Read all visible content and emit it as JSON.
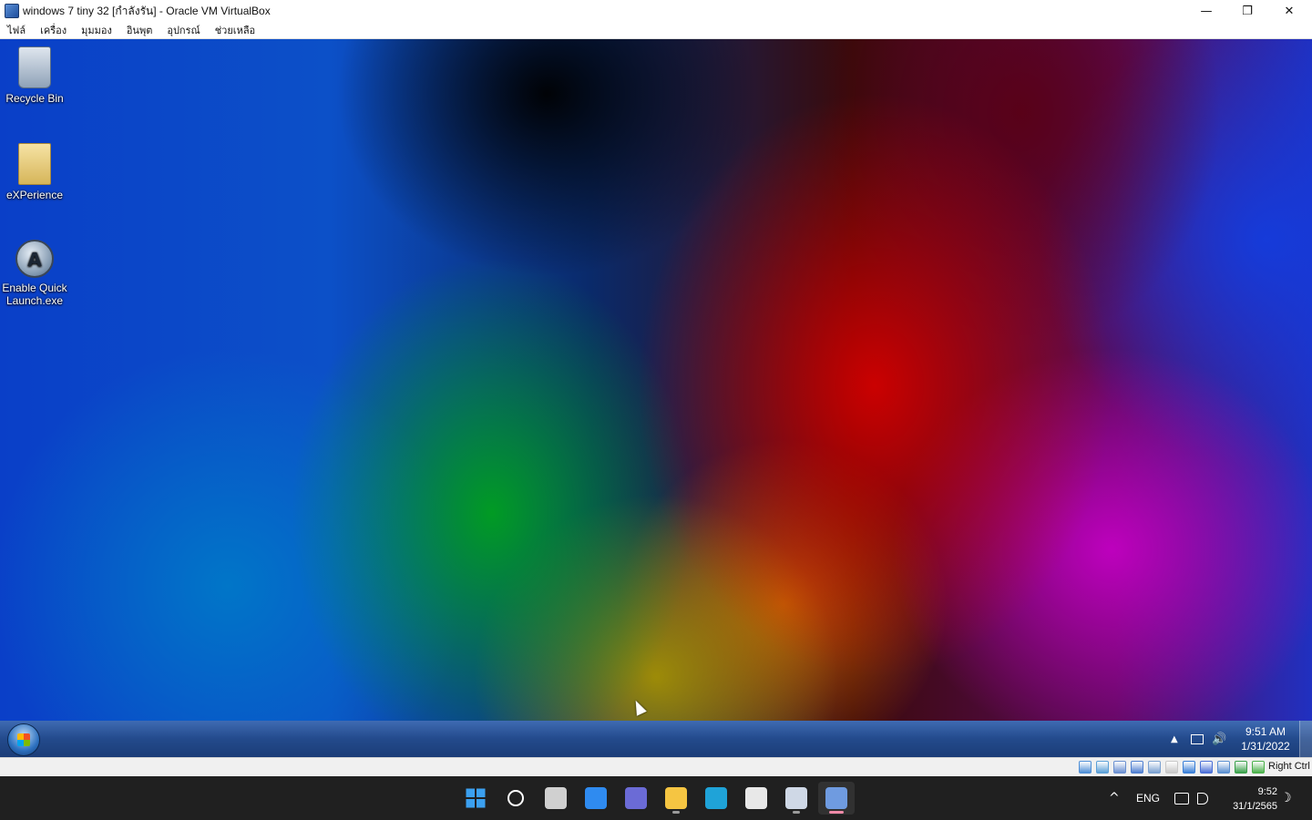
{
  "window": {
    "title": "windows 7 tiny 32 [กำลังรัน] - Oracle VM VirtualBox",
    "minimize_glyph": "—",
    "maximize_glyph": "❐",
    "close_glyph": "✕"
  },
  "menubar": {
    "items": [
      "ไฟล์",
      "เครื่อง",
      "มุมมอง",
      "อินพุต",
      "อุปกรณ์",
      "ช่วยเหลือ"
    ]
  },
  "desktop": {
    "icons": [
      {
        "label": "Recycle Bin",
        "icon": "recycle-bin-icon"
      },
      {
        "label": "eXPerience",
        "icon": "folder-icon"
      },
      {
        "label": "Enable Quick Launch.exe",
        "icon": "app-exe-icon"
      }
    ]
  },
  "guest_taskbar": {
    "start": "start-orb-icon",
    "tray": {
      "show_hidden_glyph": "▲",
      "volume_glyph": "🔊",
      "time": "9:51 AM",
      "date": "1/31/2022"
    }
  },
  "vbox_status": {
    "icons": [
      "hard-disk-icon",
      "optical-drive-icon",
      "audio-icon",
      "network-icon",
      "usb-icon",
      "shared-folders-icon",
      "display-icon",
      "recording-icon",
      "cpu-icon",
      "mouse-integration-icon",
      "keyboard-icon"
    ],
    "host_key": "Right Ctrl"
  },
  "host_taskbar": {
    "apps": [
      {
        "name": "start-icon",
        "color": "#3ba0f0"
      },
      {
        "name": "search-icon",
        "color": "#ffffff"
      },
      {
        "name": "task-view-icon",
        "color": "#d0d0d0"
      },
      {
        "name": "widgets-icon",
        "color": "#2f8bf0"
      },
      {
        "name": "chat-icon",
        "color": "#6b6bd6"
      },
      {
        "name": "file-explorer-icon",
        "color": "#f5c542"
      },
      {
        "name": "edge-icon",
        "color": "#1fa3d8"
      },
      {
        "name": "store-icon",
        "color": "#e8e8e8"
      },
      {
        "name": "virtualbox-icon",
        "color": "#cfd8e6"
      },
      {
        "name": "vm-window-icon",
        "color": "#6f9be0"
      }
    ],
    "tray": {
      "chevron_glyph": "^",
      "language": "ENG",
      "time": "9:52",
      "date": "31/1/2565",
      "notification_glyph": "☽"
    }
  }
}
